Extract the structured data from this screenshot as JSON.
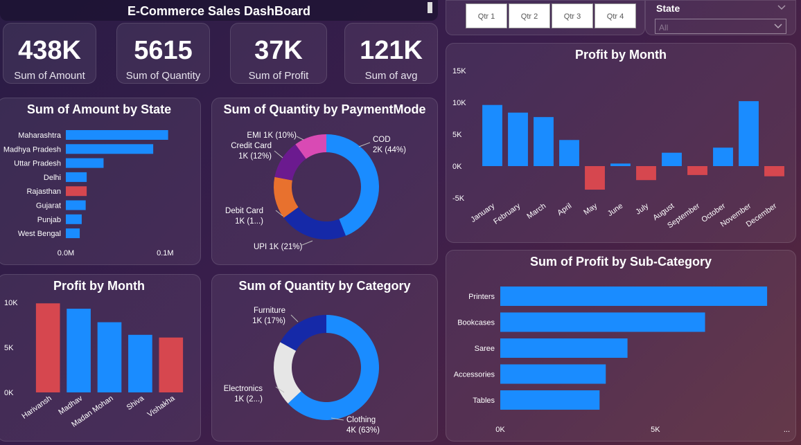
{
  "header": {
    "title": "E-Commerce Sales DashBoard"
  },
  "kpis": [
    {
      "value": "438K",
      "label": "Sum of Amount"
    },
    {
      "value": "5615",
      "label": "Sum of Quantity"
    },
    {
      "value": "37K",
      "label": "Sum of Profit"
    },
    {
      "value": "121K",
      "label": "Sum of avg"
    }
  ],
  "slicers": {
    "quarters": [
      "Qtr 1",
      "Qtr 2",
      "Qtr 3",
      "Qtr 4"
    ],
    "state": {
      "label": "State",
      "value": "All"
    }
  },
  "colors": {
    "positive": "#1a8cff",
    "negative": "#d6474f",
    "dark_blue": "#1529a8",
    "purple": "#6b1a8f",
    "pink": "#d94ab4",
    "orange": "#e8712e",
    "light_grey": "#e6e6e6"
  },
  "chart_data": [
    {
      "id": "amount_by_state",
      "type": "bar",
      "title": "Sum of Amount by State",
      "orientation": "horizontal",
      "categories": [
        "Maharashtra",
        "Madhya Pradesh",
        "Uttar Pradesh",
        "Delhi",
        "Rajasthan",
        "Gujarat",
        "Punjab",
        "West Bengal"
      ],
      "values": [
        0.103,
        0.088,
        0.038,
        0.021,
        0.021,
        0.02,
        0.016,
        0.014
      ],
      "highlight": [
        false,
        false,
        false,
        false,
        true,
        false,
        false,
        false
      ],
      "xticks": [
        "0.0M",
        "0.1M"
      ],
      "xlim": [
        0,
        0.12
      ]
    },
    {
      "id": "quantity_by_paymentmode",
      "type": "pie",
      "donut": true,
      "title": "Sum of Quantity by PaymentMode",
      "slices": [
        {
          "name": "COD",
          "label": "COD",
          "detail": "2K (44%)",
          "value": 44,
          "color": "#1a8cff"
        },
        {
          "name": "UPI",
          "label": "UPI 1K (21%)",
          "detail": "",
          "value": 21,
          "color": "#1529a8"
        },
        {
          "name": "Debit Card",
          "label": "Debit Card",
          "detail": "1K (1...)",
          "value": 13,
          "color": "#e8712e"
        },
        {
          "name": "Credit Card",
          "label": "Credit Card",
          "detail": "1K (12%)",
          "value": 12,
          "color": "#6b1a8f"
        },
        {
          "name": "EMI",
          "label": "EMI 1K (10%)",
          "detail": "",
          "value": 10,
          "color": "#d94ab4"
        }
      ]
    },
    {
      "id": "profit_by_month_large",
      "type": "bar",
      "title": "Profit by Month",
      "categories": [
        "January",
        "February",
        "March",
        "April",
        "May",
        "June",
        "July",
        "August",
        "September",
        "October",
        "November",
        "December"
      ],
      "values": [
        9600,
        8400,
        7700,
        4100,
        -3700,
        400,
        -2200,
        2100,
        -1400,
        2900,
        10200,
        -1600
      ],
      "ylim": [
        -5000,
        15000
      ],
      "yticks": [
        "15K",
        "10K",
        "5K",
        "0K",
        "-5K"
      ]
    },
    {
      "id": "profit_by_customer",
      "type": "bar",
      "title": "Profit by Month",
      "categories": [
        "Harivansh",
        "Madhav",
        "Madan Mohan",
        "Shiva",
        "Vishakha"
      ],
      "values": [
        9900,
        9300,
        7800,
        6400,
        6100
      ],
      "highlight": [
        true,
        false,
        false,
        false,
        true
      ],
      "ylim": [
        0,
        10000
      ],
      "yticks": [
        "10K",
        "5K",
        "0K"
      ]
    },
    {
      "id": "quantity_by_category",
      "type": "pie",
      "donut": true,
      "title": "Sum of Quantity by Category",
      "slices": [
        {
          "name": "Clothing",
          "label": "Clothing",
          "detail": "4K (63%)",
          "value": 63,
          "color": "#1a8cff"
        },
        {
          "name": "Electronics",
          "label": "Electronics",
          "detail": "1K (2...)",
          "value": 20,
          "color": "#e6e6e6"
        },
        {
          "name": "Furniture",
          "label": "Furniture",
          "detail": "1K (17%)",
          "value": 17,
          "color": "#1529a8"
        }
      ]
    },
    {
      "id": "profit_by_subcategory",
      "type": "bar",
      "title": "Sum of Profit by Sub-Category",
      "orientation": "horizontal",
      "categories": [
        "Printers",
        "Bookcases",
        "Saree",
        "Accessories",
        "Tables"
      ],
      "values": [
        8600,
        6600,
        4100,
        3400,
        3200
      ],
      "xlim": [
        0,
        9000
      ],
      "xticks": [
        "0K",
        "5K"
      ],
      "more_label": "..."
    }
  ]
}
